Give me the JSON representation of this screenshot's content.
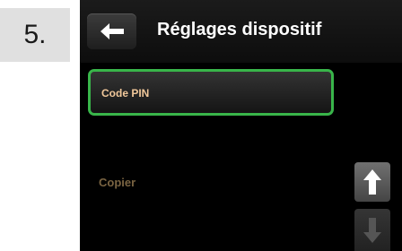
{
  "step": {
    "number": "5."
  },
  "header": {
    "back_icon": "arrow-left-icon",
    "title": "Réglages dispositif"
  },
  "list": {
    "items": [
      {
        "label": "Code PIN",
        "selected": true
      },
      {
        "label": "Copier",
        "selected": false,
        "disabled": true
      }
    ]
  },
  "scroll": {
    "up_icon": "arrow-up-icon",
    "down_icon": "arrow-down-icon",
    "down_enabled": false
  },
  "colors": {
    "selection_border": "#39b54a",
    "item_text": "#f0c79a",
    "disabled_text": "#7a6442",
    "title_text": "#ffffff"
  }
}
